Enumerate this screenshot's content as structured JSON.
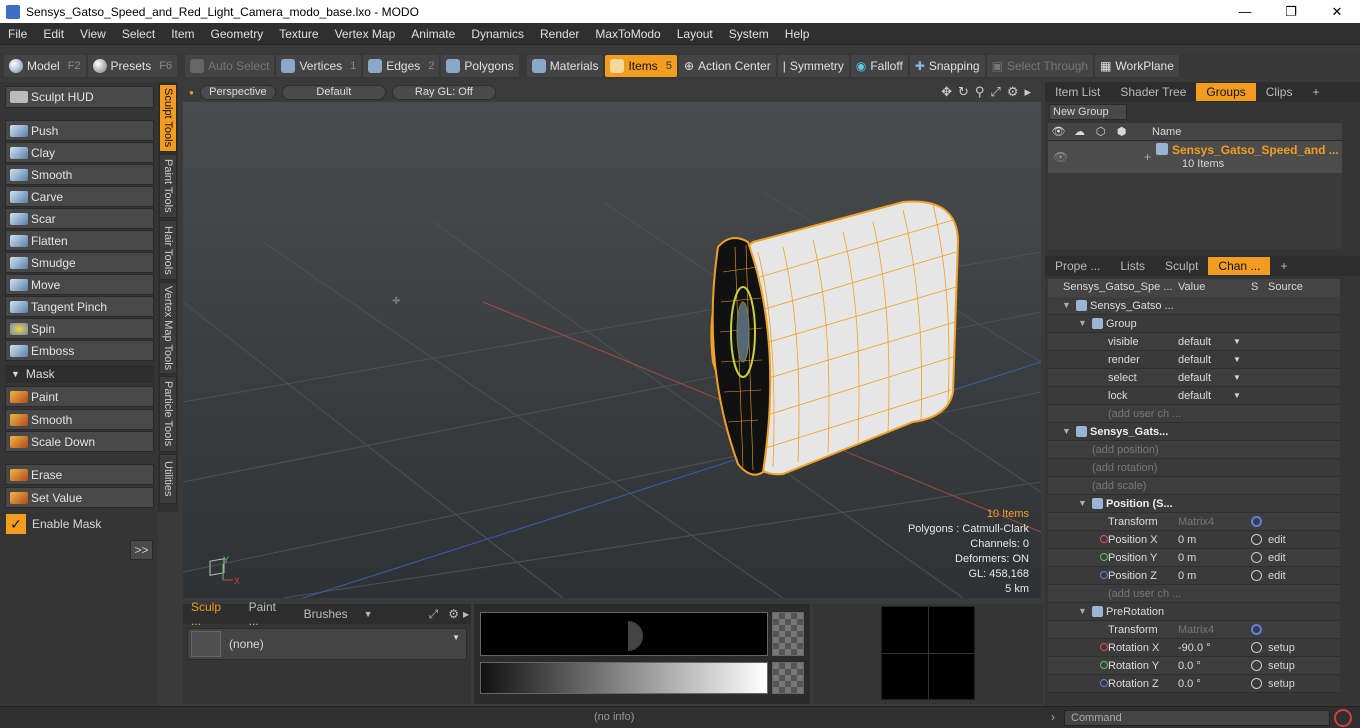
{
  "window": {
    "title": "Sensys_Gatso_Speed_and_Red_Light_Camera_modo_base.lxo - MODO"
  },
  "menu": [
    "File",
    "Edit",
    "View",
    "Select",
    "Item",
    "Geometry",
    "Texture",
    "Vertex Map",
    "Animate",
    "Dynamics",
    "Render",
    "MaxToModo",
    "Layout",
    "System",
    "Help"
  ],
  "toolbar": {
    "model": "Model",
    "model_key": "F2",
    "presets": "Presets",
    "presets_key": "F6",
    "auto_select": "Auto Select",
    "vertices": "Vertices",
    "vertices_key": "1",
    "edges": "Edges",
    "edges_key": "2",
    "polygons": "Polygons",
    "materials": "Materials",
    "items": "Items",
    "items_key": "5",
    "action_center": "Action Center",
    "symmetry": "Symmetry",
    "falloff": "Falloff",
    "snapping": "Snapping",
    "select_through": "Select Through",
    "workplane": "WorkPlane"
  },
  "left": {
    "sculpt_hud": "Sculpt HUD",
    "tools": [
      "Push",
      "Clay",
      "Smooth",
      "Carve",
      "Scar",
      "Flatten",
      "Smudge",
      "Move",
      "Tangent Pinch",
      "Spin",
      "Emboss"
    ],
    "mask_header": "Mask",
    "mask_tools": [
      "Paint",
      "Smooth",
      "Scale Down"
    ],
    "erase": "Erase",
    "set_value": "Set Value",
    "enable_mask": "Enable Mask",
    "expand": ">>"
  },
  "vtabs": [
    "Sculpt Tools",
    "Paint Tools",
    "Hair Tools",
    "Vertex Map Tools",
    "Particle Tools",
    "Utilities"
  ],
  "viewport": {
    "perspective": "Perspective",
    "default": "Default",
    "raygl": "Ray GL: Off",
    "info": {
      "items": "10 Items",
      "polygons": "Polygons : Catmull-Clark",
      "channels": "Channels: 0",
      "deformers": "Deformers: ON",
      "gl": "GL: 458,168",
      "scale": "5 km"
    },
    "axis_y": "Y",
    "axis_x": "X"
  },
  "bottom_left": {
    "tabs": [
      "Sculp ...",
      "Paint ...",
      "Brushes"
    ],
    "preset": "(none)"
  },
  "right": {
    "top_tabs": [
      "Item List",
      "Shader Tree",
      "Groups",
      "Clips"
    ],
    "new_group": "New Group",
    "col_name": "Name",
    "group_name": "Sensys_Gatso_Speed_and ...",
    "group_count": "10 Items",
    "chan_tabs": [
      "Prope ...",
      "Lists",
      "Sculpt",
      "Chan ..."
    ],
    "chan_cols": {
      "name": "Sensys_Gatso_Spe ...",
      "value": "Value",
      "s": "S",
      "source": "Source"
    },
    "rows": [
      {
        "label": "Sensys_Gatso ...",
        "value": "",
        "source": "",
        "indent": 1,
        "kind": "item"
      },
      {
        "label": "Group",
        "value": "",
        "source": "",
        "indent": 2,
        "kind": "item"
      },
      {
        "label": "visible",
        "value": "default",
        "source": "",
        "indent": 3,
        "kind": "drop"
      },
      {
        "label": "render",
        "value": "default",
        "source": "",
        "indent": 3,
        "kind": "drop"
      },
      {
        "label": "select",
        "value": "default",
        "source": "",
        "indent": 3,
        "kind": "drop"
      },
      {
        "label": "lock",
        "value": "default",
        "source": "",
        "indent": 3,
        "kind": "drop"
      },
      {
        "label": "(add user ch ...",
        "value": "",
        "source": "",
        "indent": 3,
        "kind": "dim"
      },
      {
        "label": "Sensys_Gats...",
        "value": "",
        "source": "",
        "indent": 1,
        "kind": "bold"
      },
      {
        "label": "(add position)",
        "value": "",
        "source": "",
        "indent": 2,
        "kind": "dim"
      },
      {
        "label": "(add rotation)",
        "value": "",
        "source": "",
        "indent": 2,
        "kind": "dim"
      },
      {
        "label": "(add scale)",
        "value": "",
        "source": "",
        "indent": 2,
        "kind": "dim"
      },
      {
        "label": "Position (S...",
        "value": "",
        "source": "",
        "indent": 2,
        "kind": "bold"
      },
      {
        "label": "Transform",
        "value": "Matrix4",
        "source": "",
        "indent": 3,
        "kind": "matrix"
      },
      {
        "label": "Position X",
        "value": "0 m",
        "source": "edit",
        "indent": 3,
        "kind": "red"
      },
      {
        "label": "Position Y",
        "value": "0 m",
        "source": "edit",
        "indent": 3,
        "kind": "green"
      },
      {
        "label": "Position Z",
        "value": "0 m",
        "source": "edit",
        "indent": 3,
        "kind": "blue"
      },
      {
        "label": "(add user ch ...",
        "value": "",
        "source": "",
        "indent": 3,
        "kind": "dim"
      },
      {
        "label": "PreRotation",
        "value": "",
        "source": "",
        "indent": 2,
        "kind": "item"
      },
      {
        "label": "Transform",
        "value": "Matrix4",
        "source": "",
        "indent": 3,
        "kind": "matrix"
      },
      {
        "label": "Rotation X",
        "value": "-90.0 °",
        "source": "setup",
        "indent": 3,
        "kind": "red"
      },
      {
        "label": "Rotation Y",
        "value": "0.0 °",
        "source": "setup",
        "indent": 3,
        "kind": "green"
      },
      {
        "label": "Rotation Z",
        "value": "0.0 °",
        "source": "setup",
        "indent": 3,
        "kind": "blue"
      }
    ]
  },
  "status": {
    "info": "(no info)",
    "command_placeholder": "Command"
  },
  "colors": {
    "accent": "#f29d1f",
    "panel": "#353535"
  }
}
